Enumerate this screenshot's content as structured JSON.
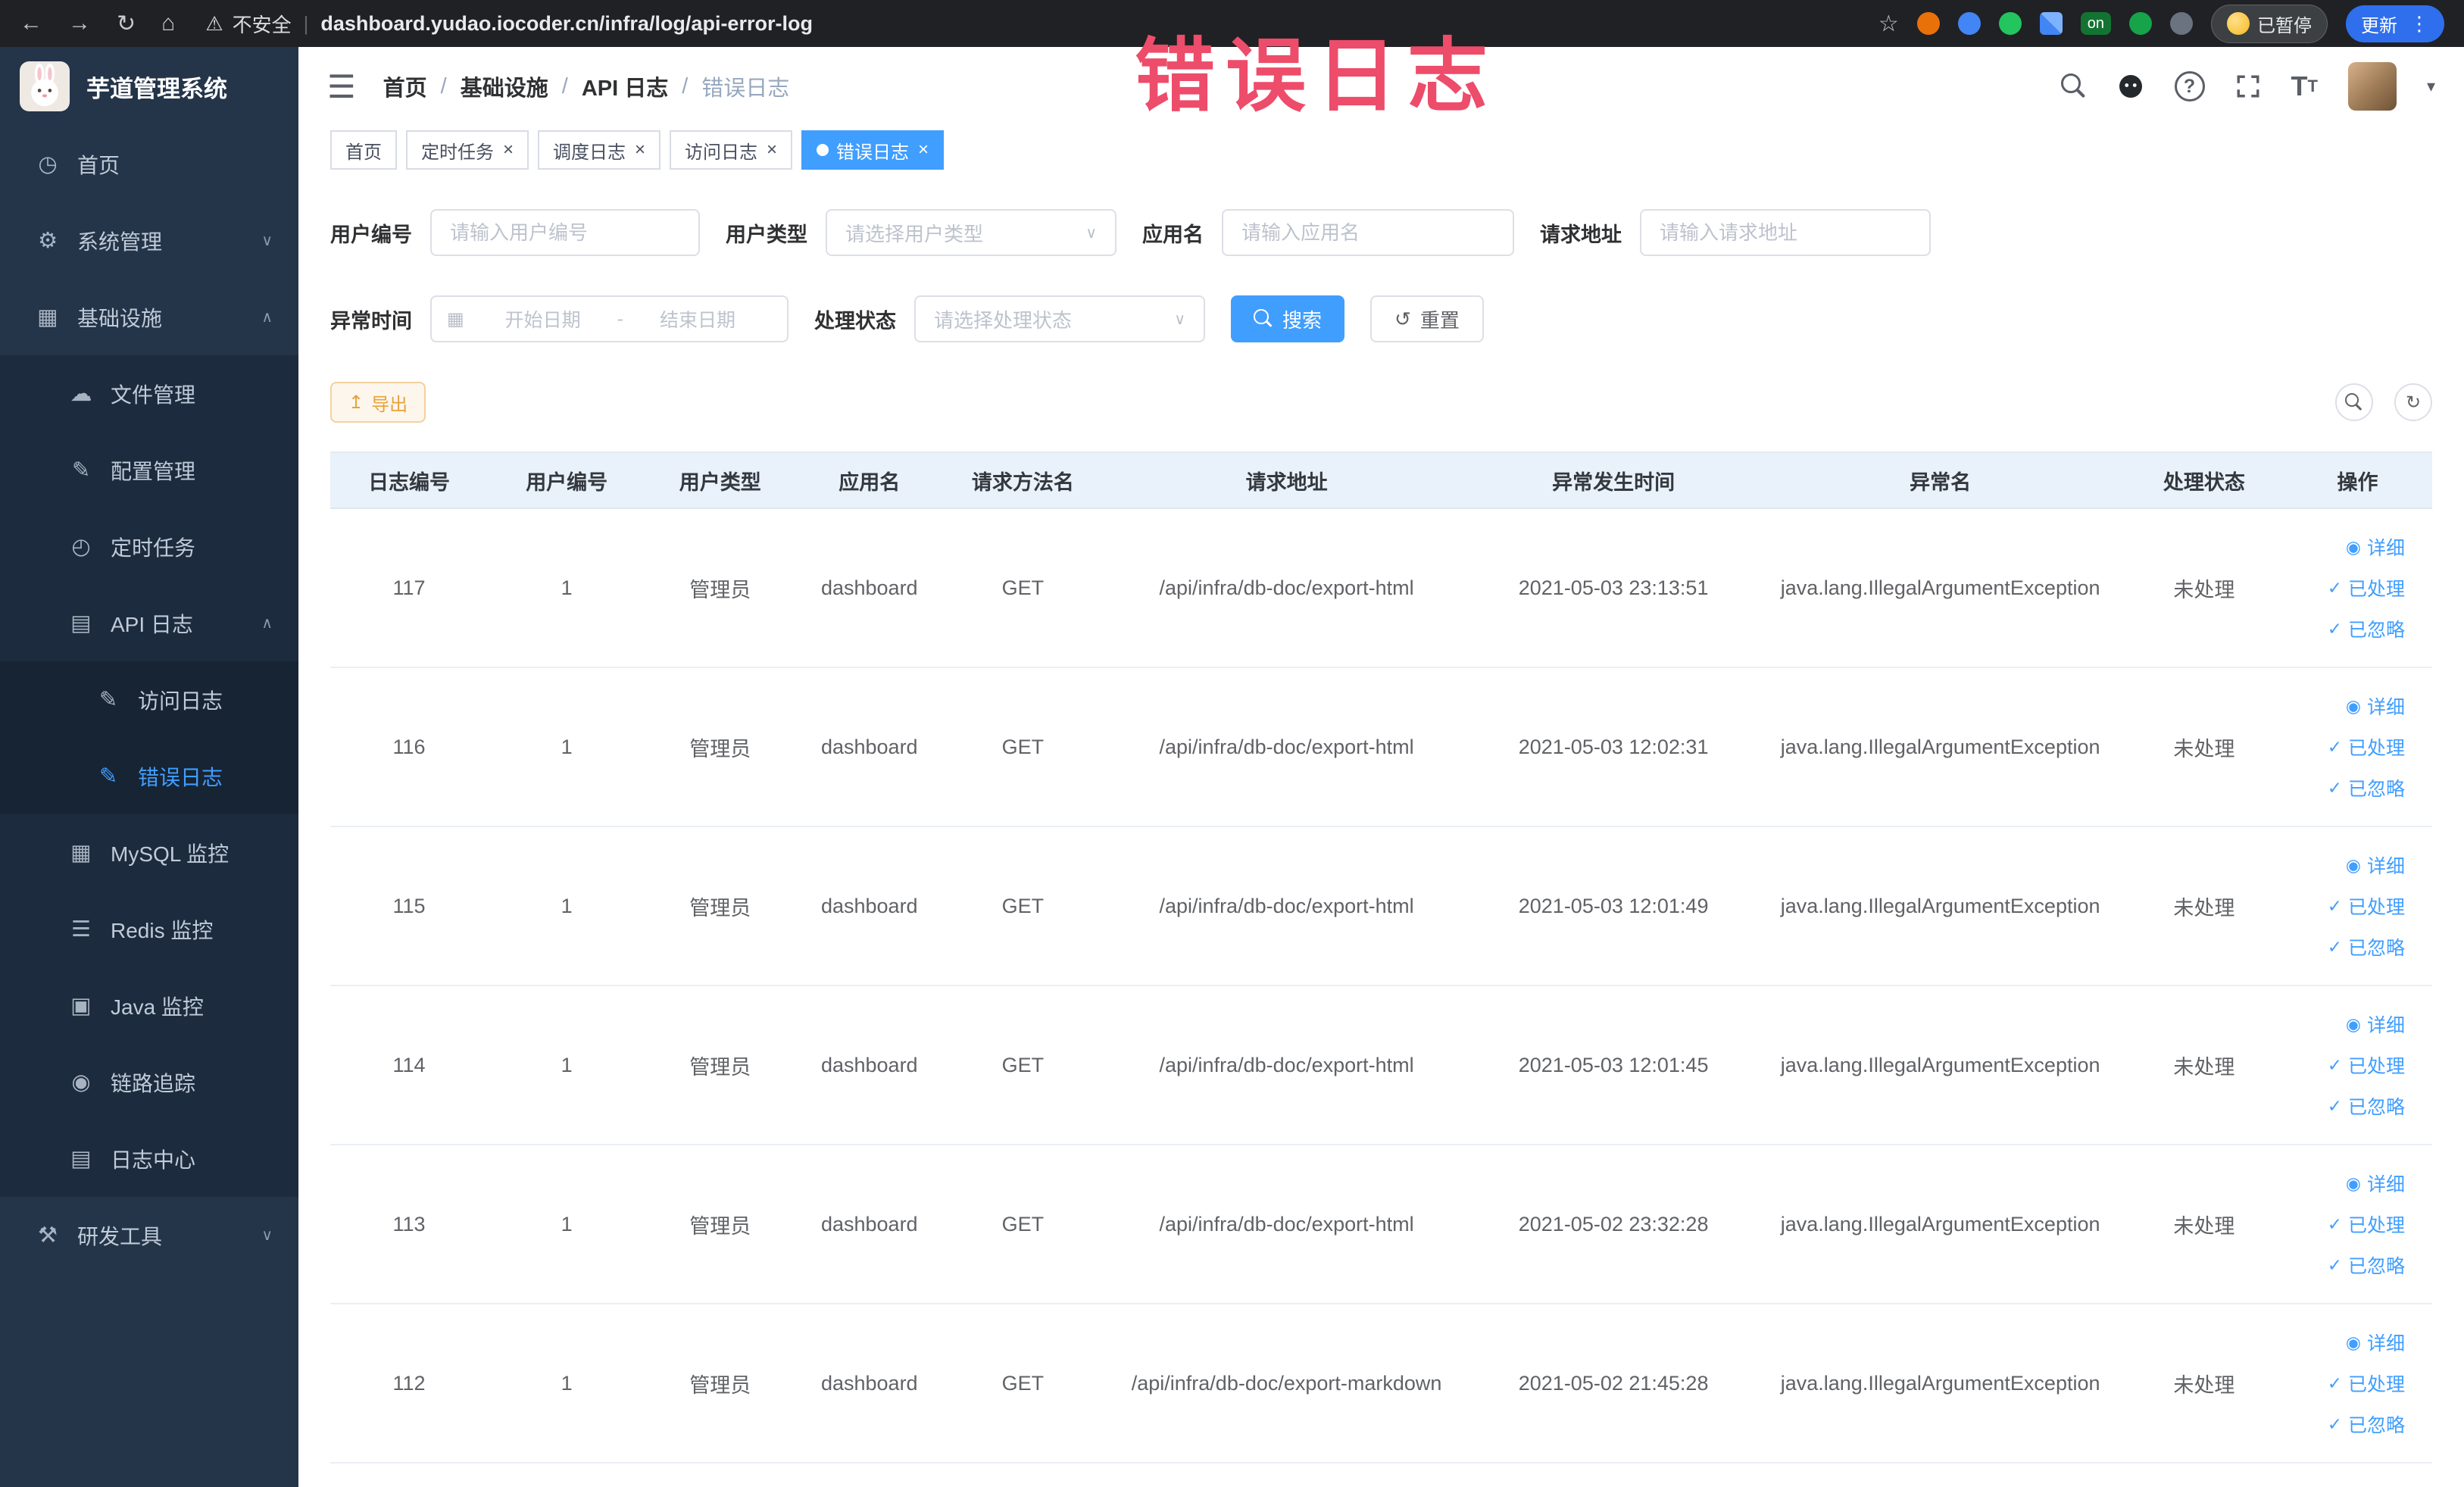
{
  "watermark_text": "错误日志",
  "browser_chrome": {
    "security_label": "不安全",
    "url": "dashboard.yudao.iocoder.cn/infra/log/api-error-log",
    "on_badge": "on",
    "paused_button": "已暂停",
    "update_button": "更新"
  },
  "icons": {
    "home-icon": "◷",
    "gear-icon": "⚙",
    "infrastructure-icon": "▦",
    "file-icon": "☁",
    "config-icon": "✎",
    "schedule-icon": "◴",
    "api-log-icon": "▤",
    "access-log-icon": "✎",
    "error-log-icon": "✎",
    "mysql-icon": "▦",
    "redis-icon": "☰",
    "java-icon": "▣",
    "trace-icon": "◉",
    "log-center-icon": "▤",
    "tools-icon": "⚒",
    "eye-icon": "◉",
    "check-icon": "✓",
    "calendar-icon": "▦",
    "refresh-icon": "↻",
    "reset-icon": "↺",
    "export-icon": "↥",
    "close-icon": "×",
    "chevron-up": "∧",
    "chevron-down": "∨"
  },
  "sidebar": {
    "logo_title": "芋道管理系统",
    "items": [
      {
        "label": "首页",
        "icon": "home-icon",
        "level": 0,
        "chevron": "",
        "active": false
      },
      {
        "label": "系统管理",
        "icon": "gear-icon",
        "level": 0,
        "chevron": "down",
        "active": false
      },
      {
        "label": "基础设施",
        "icon": "infrastructure-icon",
        "level": 0,
        "chevron": "up",
        "active": false
      },
      {
        "label": "文件管理",
        "icon": "file-icon",
        "level": 1,
        "chevron": "",
        "active": false
      },
      {
        "label": "配置管理",
        "icon": "config-icon",
        "level": 1,
        "chevron": "",
        "active": false
      },
      {
        "label": "定时任务",
        "icon": "schedule-icon",
        "level": 1,
        "chevron": "",
        "active": false
      },
      {
        "label": "API 日志",
        "icon": "api-log-icon",
        "level": 1,
        "chevron": "up",
        "active": false
      },
      {
        "label": "访问日志",
        "icon": "access-log-icon",
        "level": 2,
        "chevron": "",
        "active": false
      },
      {
        "label": "错误日志",
        "icon": "error-log-icon",
        "level": 2,
        "chevron": "",
        "active": true
      },
      {
        "label": "MySQL 监控",
        "icon": "mysql-icon",
        "level": 1,
        "chevron": "",
        "active": false
      },
      {
        "label": "Redis 监控",
        "icon": "redis-icon",
        "level": 1,
        "chevron": "",
        "active": false
      },
      {
        "label": "Java 监控",
        "icon": "java-icon",
        "level": 1,
        "chevron": "",
        "active": false
      },
      {
        "label": "链路追踪",
        "icon": "trace-icon",
        "level": 1,
        "chevron": "",
        "active": false
      },
      {
        "label": "日志中心",
        "icon": "log-center-icon",
        "level": 1,
        "chevron": "",
        "active": false
      },
      {
        "label": "研发工具",
        "icon": "tools-icon",
        "level": 0,
        "chevron": "down",
        "active": false
      }
    ]
  },
  "header": {
    "breadcrumb": [
      "首页",
      "基础设施",
      "API 日志",
      "错误日志"
    ]
  },
  "tabs": [
    {
      "label": "首页",
      "closable": false,
      "active": false
    },
    {
      "label": "定时任务",
      "closable": true,
      "active": false
    },
    {
      "label": "调度日志",
      "closable": true,
      "active": false
    },
    {
      "label": "访问日志",
      "closable": true,
      "active": false
    },
    {
      "label": "错误日志",
      "closable": true,
      "active": true
    }
  ],
  "filters": {
    "user_id_label": "用户编号",
    "user_id_placeholder": "请输入用户编号",
    "user_type_label": "用户类型",
    "user_type_placeholder": "请选择用户类型",
    "app_name_label": "应用名",
    "app_name_placeholder": "请输入应用名",
    "request_url_label": "请求地址",
    "request_url_placeholder": "请输入请求地址",
    "exception_time_label": "异常时间",
    "start_date_placeholder": "开始日期",
    "range_separator": "-",
    "end_date_placeholder": "结束日期",
    "process_status_label": "处理状态",
    "process_status_placeholder": "请选择处理状态",
    "search_label": "搜索",
    "reset_label": "重置"
  },
  "toolbar": {
    "export_label": "导出"
  },
  "table": {
    "headers": [
      "日志编号",
      "用户编号",
      "用户类型",
      "应用名",
      "请求方法名",
      "请求地址",
      "异常发生时间",
      "异常名",
      "处理状态",
      "操作"
    ],
    "row_actions": [
      "详细",
      "已处理",
      "已忽略"
    ],
    "rows": [
      {
        "id": "117",
        "user_id": "1",
        "user_type": "管理员",
        "app_name": "dashboard",
        "method": "GET",
        "request_url": "/api/infra/db-doc/export-html",
        "time": "2021-05-03 23:13:51",
        "exception": "java.lang.IllegalArgumentException",
        "status": "未处理"
      },
      {
        "id": "116",
        "user_id": "1",
        "user_type": "管理员",
        "app_name": "dashboard",
        "method": "GET",
        "request_url": "/api/infra/db-doc/export-html",
        "time": "2021-05-03 12:02:31",
        "exception": "java.lang.IllegalArgumentException",
        "status": "未处理"
      },
      {
        "id": "115",
        "user_id": "1",
        "user_type": "管理员",
        "app_name": "dashboard",
        "method": "GET",
        "request_url": "/api/infra/db-doc/export-html",
        "time": "2021-05-03 12:01:49",
        "exception": "java.lang.IllegalArgumentException",
        "status": "未处理"
      },
      {
        "id": "114",
        "user_id": "1",
        "user_type": "管理员",
        "app_name": "dashboard",
        "method": "GET",
        "request_url": "/api/infra/db-doc/export-html",
        "time": "2021-05-03 12:01:45",
        "exception": "java.lang.IllegalArgumentException",
        "status": "未处理"
      },
      {
        "id": "113",
        "user_id": "1",
        "user_type": "管理员",
        "app_name": "dashboard",
        "method": "GET",
        "request_url": "/api/infra/db-doc/export-html",
        "time": "2021-05-02 23:32:28",
        "exception": "java.lang.IllegalArgumentException",
        "status": "未处理"
      },
      {
        "id": "112",
        "user_id": "1",
        "user_type": "管理员",
        "app_name": "dashboard",
        "method": "GET",
        "request_url": "/api/infra/db-doc/export-markdown",
        "time": "2021-05-02 21:45:28",
        "exception": "java.lang.IllegalArgumentException",
        "status": "未处理"
      }
    ]
  }
}
